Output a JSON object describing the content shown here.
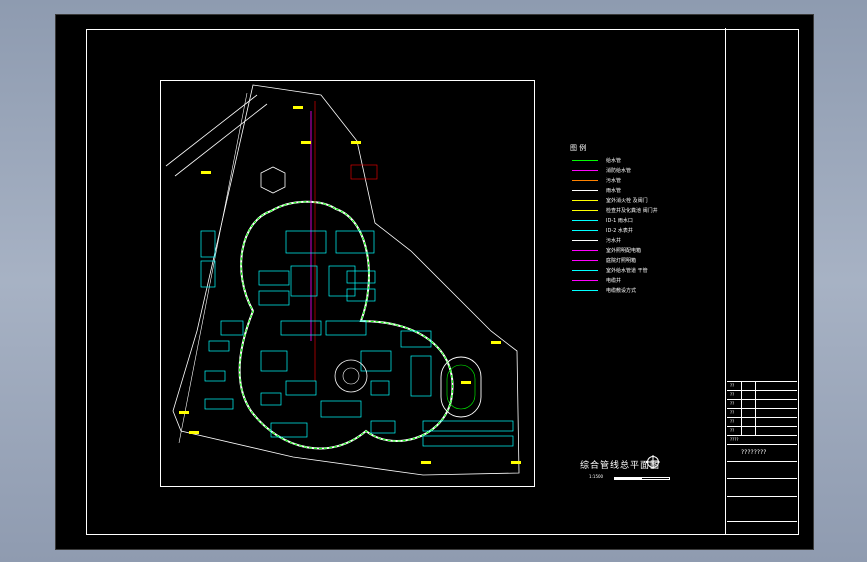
{
  "drawing": {
    "title": "综合管线总平面图",
    "scale_label": "1:1500",
    "project_name": "????????",
    "legend_title": "图 例",
    "legend": [
      {
        "label": "给水管",
        "color": "#00ff00"
      },
      {
        "label": "消防给水管",
        "color": "#ff00ff"
      },
      {
        "label": "污水管",
        "color": "#ff8000"
      },
      {
        "label": "雨水管",
        "color": "#ffffff"
      },
      {
        "label": "室外消火栓 及阀门",
        "color": "#ffff00"
      },
      {
        "label": "检查井及化粪池 阀门井",
        "color": "#ffff00"
      },
      {
        "label": "ID-1 雨水口",
        "color": "#00ffff"
      },
      {
        "label": "ID-2 水表井",
        "color": "#00ffff"
      },
      {
        "label": "污水井",
        "color": "#ffffff"
      },
      {
        "label": "室外照明配电箱",
        "color": "#ff00ff"
      },
      {
        "label": "庭院灯照明箱",
        "color": "#ff00ff"
      },
      {
        "label": "室外给水管道 干管",
        "color": "#00ffff"
      },
      {
        "label": "电缆井",
        "color": "#ff00ff"
      },
      {
        "label": "电缆敷设方式",
        "color": "#00ffff"
      }
    ],
    "title_block": [
      "??",
      "??",
      "??",
      "??",
      "??",
      "??",
      "????"
    ],
    "colors": {
      "background": "#000000",
      "frame": "#ffffff",
      "water": "#00ff00",
      "fire": "#ff00ff",
      "road": "#ffffff",
      "building": "#00ffff",
      "label": "#ffff00",
      "sewer": "#ff0000"
    }
  }
}
